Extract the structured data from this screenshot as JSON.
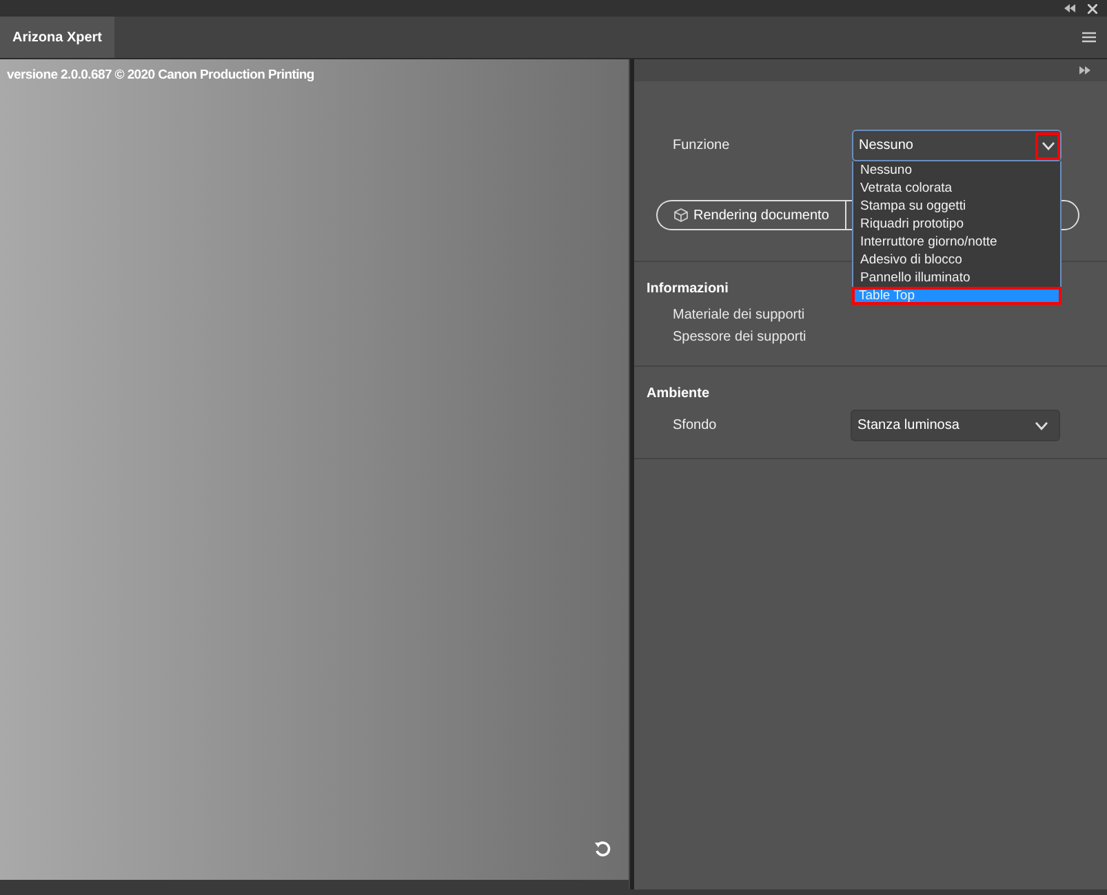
{
  "tabs": [
    {
      "label": "Arizona Xpert",
      "selected": true
    }
  ],
  "viewport": {
    "version_text": "versione 2.0.0.687 © 2020 Canon Production Printing"
  },
  "funzione": {
    "label": "Funzione",
    "value": "Nessuno",
    "expanded": true,
    "chevron_highlighted": true,
    "options": [
      {
        "label": "Nessuno",
        "highlighted": false
      },
      {
        "label": "Vetrata colorata",
        "highlighted": false
      },
      {
        "label": "Stampa su oggetti",
        "highlighted": false
      },
      {
        "label": "Riquadri prototipo",
        "highlighted": false
      },
      {
        "label": "Interruttore giorno/notte",
        "highlighted": false
      },
      {
        "label": "Adesivo di blocco",
        "highlighted": false
      },
      {
        "label": "Pannello illuminato",
        "highlighted": false
      },
      {
        "label": "Table Top",
        "highlighted": true
      }
    ]
  },
  "render_button": {
    "label": "Rendering documento"
  },
  "informazioni": {
    "title": "Informazioni",
    "rows": [
      "Materiale dei supporti",
      "Spessore dei supporti"
    ]
  },
  "ambiente": {
    "title": "Ambiente",
    "label": "Sfondo",
    "value": "Stanza luminosa"
  }
}
